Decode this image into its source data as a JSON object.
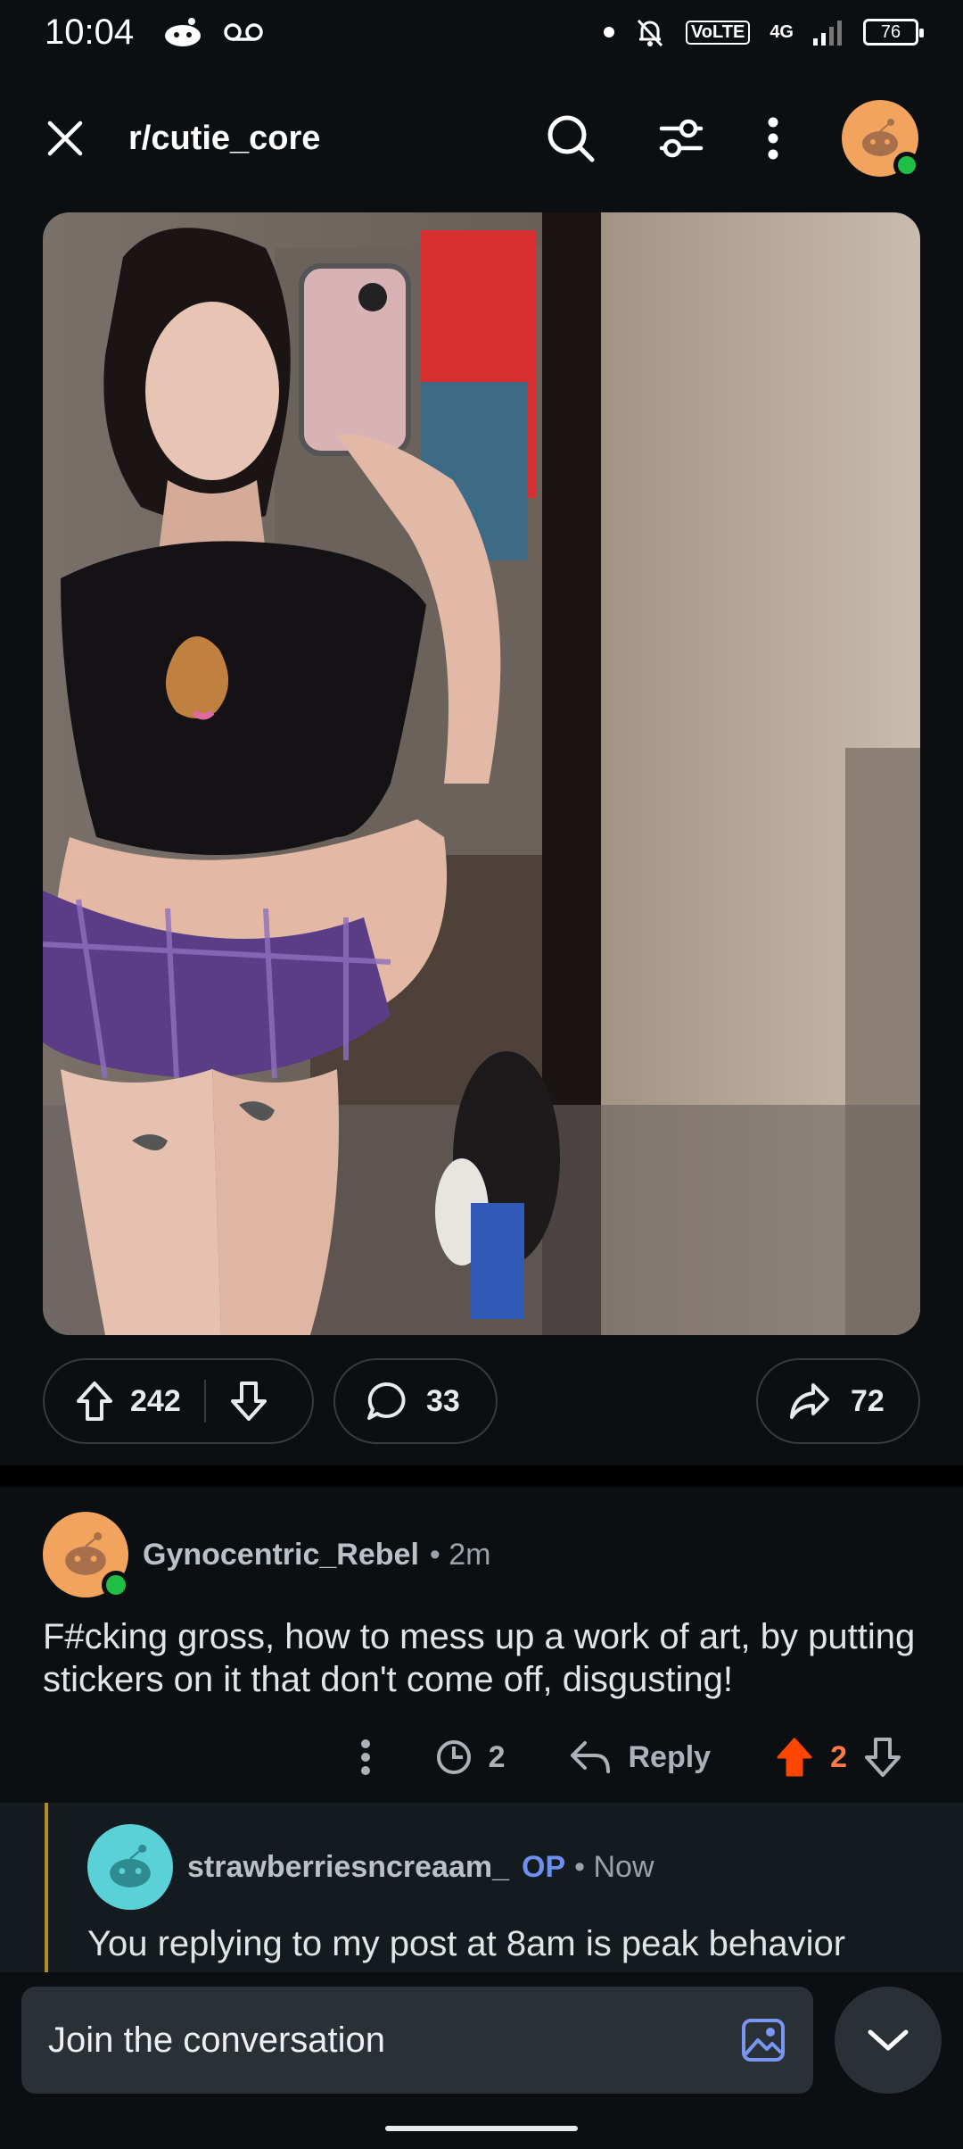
{
  "status_bar": {
    "time": "10:04",
    "network": "4G",
    "volte": "VoLTE",
    "battery": "76"
  },
  "header": {
    "subreddit": "r/cutie_core"
  },
  "post": {
    "image_alt": "mirror selfie photo",
    "actions": {
      "upvotes": "242",
      "comments": "33",
      "shares": "72"
    }
  },
  "comment": {
    "username": "Gynocentric_Rebel",
    "time": "• 2m",
    "body": "F#cking gross, how to mess up a work of art, by putting stickers on it that don't come off, disgusting!",
    "awards_count": "2",
    "reply_label": "Reply",
    "score": "2"
  },
  "reply": {
    "username": "strawberriesncreaam_",
    "op_badge": "OP",
    "time": "• Now",
    "body": "You replying to my post at 8am is peak behavior"
  },
  "composer": {
    "placeholder": "Join the conversation"
  },
  "colors": {
    "background": "#0b0f12",
    "upvote_active": "#ff4500",
    "op": "#6f8ff0",
    "thread_line": "#b38b1e"
  }
}
